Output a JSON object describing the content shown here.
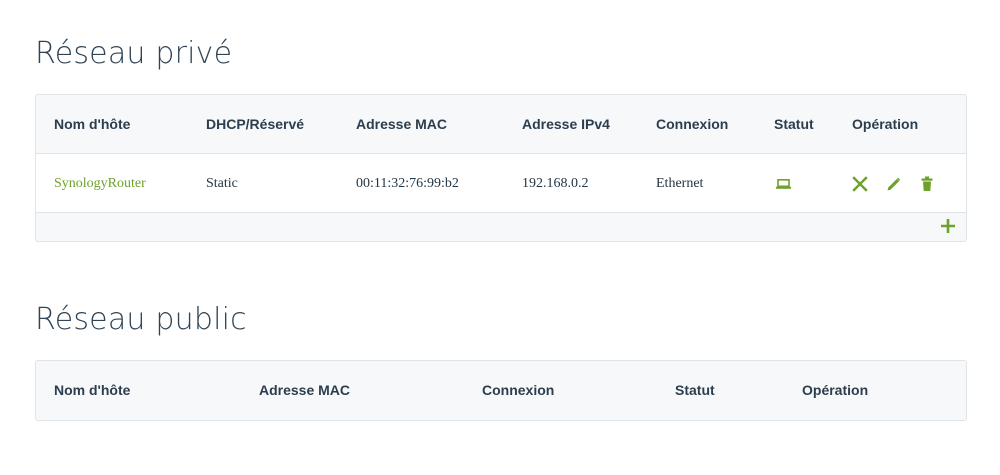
{
  "private_section": {
    "title": "Réseau privé",
    "headers": {
      "hostname": "Nom d'hôte",
      "dhcp": "DHCP/Réservé",
      "mac": "Adresse MAC",
      "ipv4": "Adresse IPv4",
      "connection": "Connexion",
      "status": "Statut",
      "operation": "Opération"
    },
    "rows": [
      {
        "hostname": "SynologyRouter",
        "dhcp": "Static",
        "mac": "00:11:32:76:99:b2",
        "ipv4": "192.168.0.2",
        "connection": "Ethernet",
        "status_icon": "laptop-icon",
        "operation_icons": [
          "close-icon",
          "pencil-icon",
          "trash-icon"
        ]
      }
    ],
    "add_icon": "plus-icon"
  },
  "public_section": {
    "title": "Réseau public",
    "headers": {
      "hostname": "Nom d'hôte",
      "mac": "Adresse MAC",
      "connection": "Connexion",
      "status": "Statut",
      "operation": "Opération"
    }
  },
  "colors": {
    "accent": "#6ea12b",
    "title": "#304455",
    "border": "#dfe4e8",
    "panel_bg": "#f6f8fa"
  }
}
